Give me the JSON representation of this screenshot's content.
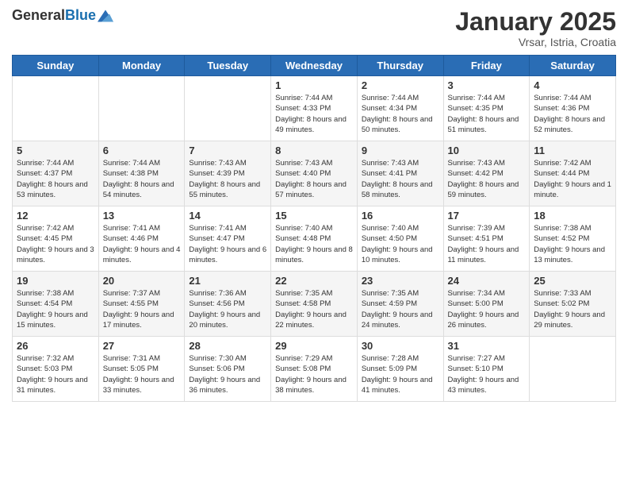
{
  "logo": {
    "general": "General",
    "blue": "Blue"
  },
  "header": {
    "title": "January 2025",
    "location": "Vrsar, Istria, Croatia"
  },
  "weekdays": [
    "Sunday",
    "Monday",
    "Tuesday",
    "Wednesday",
    "Thursday",
    "Friday",
    "Saturday"
  ],
  "weeks": [
    [
      {
        "day": "",
        "sunrise": "",
        "sunset": "",
        "daylight": ""
      },
      {
        "day": "",
        "sunrise": "",
        "sunset": "",
        "daylight": ""
      },
      {
        "day": "",
        "sunrise": "",
        "sunset": "",
        "daylight": ""
      },
      {
        "day": "1",
        "sunrise": "Sunrise: 7:44 AM",
        "sunset": "Sunset: 4:33 PM",
        "daylight": "Daylight: 8 hours and 49 minutes."
      },
      {
        "day": "2",
        "sunrise": "Sunrise: 7:44 AM",
        "sunset": "Sunset: 4:34 PM",
        "daylight": "Daylight: 8 hours and 50 minutes."
      },
      {
        "day": "3",
        "sunrise": "Sunrise: 7:44 AM",
        "sunset": "Sunset: 4:35 PM",
        "daylight": "Daylight: 8 hours and 51 minutes."
      },
      {
        "day": "4",
        "sunrise": "Sunrise: 7:44 AM",
        "sunset": "Sunset: 4:36 PM",
        "daylight": "Daylight: 8 hours and 52 minutes."
      }
    ],
    [
      {
        "day": "5",
        "sunrise": "Sunrise: 7:44 AM",
        "sunset": "Sunset: 4:37 PM",
        "daylight": "Daylight: 8 hours and 53 minutes."
      },
      {
        "day": "6",
        "sunrise": "Sunrise: 7:44 AM",
        "sunset": "Sunset: 4:38 PM",
        "daylight": "Daylight: 8 hours and 54 minutes."
      },
      {
        "day": "7",
        "sunrise": "Sunrise: 7:43 AM",
        "sunset": "Sunset: 4:39 PM",
        "daylight": "Daylight: 8 hours and 55 minutes."
      },
      {
        "day": "8",
        "sunrise": "Sunrise: 7:43 AM",
        "sunset": "Sunset: 4:40 PM",
        "daylight": "Daylight: 8 hours and 57 minutes."
      },
      {
        "day": "9",
        "sunrise": "Sunrise: 7:43 AM",
        "sunset": "Sunset: 4:41 PM",
        "daylight": "Daylight: 8 hours and 58 minutes."
      },
      {
        "day": "10",
        "sunrise": "Sunrise: 7:43 AM",
        "sunset": "Sunset: 4:42 PM",
        "daylight": "Daylight: 8 hours and 59 minutes."
      },
      {
        "day": "11",
        "sunrise": "Sunrise: 7:42 AM",
        "sunset": "Sunset: 4:44 PM",
        "daylight": "Daylight: 9 hours and 1 minute."
      }
    ],
    [
      {
        "day": "12",
        "sunrise": "Sunrise: 7:42 AM",
        "sunset": "Sunset: 4:45 PM",
        "daylight": "Daylight: 9 hours and 3 minutes."
      },
      {
        "day": "13",
        "sunrise": "Sunrise: 7:41 AM",
        "sunset": "Sunset: 4:46 PM",
        "daylight": "Daylight: 9 hours and 4 minutes."
      },
      {
        "day": "14",
        "sunrise": "Sunrise: 7:41 AM",
        "sunset": "Sunset: 4:47 PM",
        "daylight": "Daylight: 9 hours and 6 minutes."
      },
      {
        "day": "15",
        "sunrise": "Sunrise: 7:40 AM",
        "sunset": "Sunset: 4:48 PM",
        "daylight": "Daylight: 9 hours and 8 minutes."
      },
      {
        "day": "16",
        "sunrise": "Sunrise: 7:40 AM",
        "sunset": "Sunset: 4:50 PM",
        "daylight": "Daylight: 9 hours and 10 minutes."
      },
      {
        "day": "17",
        "sunrise": "Sunrise: 7:39 AM",
        "sunset": "Sunset: 4:51 PM",
        "daylight": "Daylight: 9 hours and 11 minutes."
      },
      {
        "day": "18",
        "sunrise": "Sunrise: 7:38 AM",
        "sunset": "Sunset: 4:52 PM",
        "daylight": "Daylight: 9 hours and 13 minutes."
      }
    ],
    [
      {
        "day": "19",
        "sunrise": "Sunrise: 7:38 AM",
        "sunset": "Sunset: 4:54 PM",
        "daylight": "Daylight: 9 hours and 15 minutes."
      },
      {
        "day": "20",
        "sunrise": "Sunrise: 7:37 AM",
        "sunset": "Sunset: 4:55 PM",
        "daylight": "Daylight: 9 hours and 17 minutes."
      },
      {
        "day": "21",
        "sunrise": "Sunrise: 7:36 AM",
        "sunset": "Sunset: 4:56 PM",
        "daylight": "Daylight: 9 hours and 20 minutes."
      },
      {
        "day": "22",
        "sunrise": "Sunrise: 7:35 AM",
        "sunset": "Sunset: 4:58 PM",
        "daylight": "Daylight: 9 hours and 22 minutes."
      },
      {
        "day": "23",
        "sunrise": "Sunrise: 7:35 AM",
        "sunset": "Sunset: 4:59 PM",
        "daylight": "Daylight: 9 hours and 24 minutes."
      },
      {
        "day": "24",
        "sunrise": "Sunrise: 7:34 AM",
        "sunset": "Sunset: 5:00 PM",
        "daylight": "Daylight: 9 hours and 26 minutes."
      },
      {
        "day": "25",
        "sunrise": "Sunrise: 7:33 AM",
        "sunset": "Sunset: 5:02 PM",
        "daylight": "Daylight: 9 hours and 29 minutes."
      }
    ],
    [
      {
        "day": "26",
        "sunrise": "Sunrise: 7:32 AM",
        "sunset": "Sunset: 5:03 PM",
        "daylight": "Daylight: 9 hours and 31 minutes."
      },
      {
        "day": "27",
        "sunrise": "Sunrise: 7:31 AM",
        "sunset": "Sunset: 5:05 PM",
        "daylight": "Daylight: 9 hours and 33 minutes."
      },
      {
        "day": "28",
        "sunrise": "Sunrise: 7:30 AM",
        "sunset": "Sunset: 5:06 PM",
        "daylight": "Daylight: 9 hours and 36 minutes."
      },
      {
        "day": "29",
        "sunrise": "Sunrise: 7:29 AM",
        "sunset": "Sunset: 5:08 PM",
        "daylight": "Daylight: 9 hours and 38 minutes."
      },
      {
        "day": "30",
        "sunrise": "Sunrise: 7:28 AM",
        "sunset": "Sunset: 5:09 PM",
        "daylight": "Daylight: 9 hours and 41 minutes."
      },
      {
        "day": "31",
        "sunrise": "Sunrise: 7:27 AM",
        "sunset": "Sunset: 5:10 PM",
        "daylight": "Daylight: 9 hours and 43 minutes."
      },
      {
        "day": "",
        "sunrise": "",
        "sunset": "",
        "daylight": ""
      }
    ]
  ]
}
